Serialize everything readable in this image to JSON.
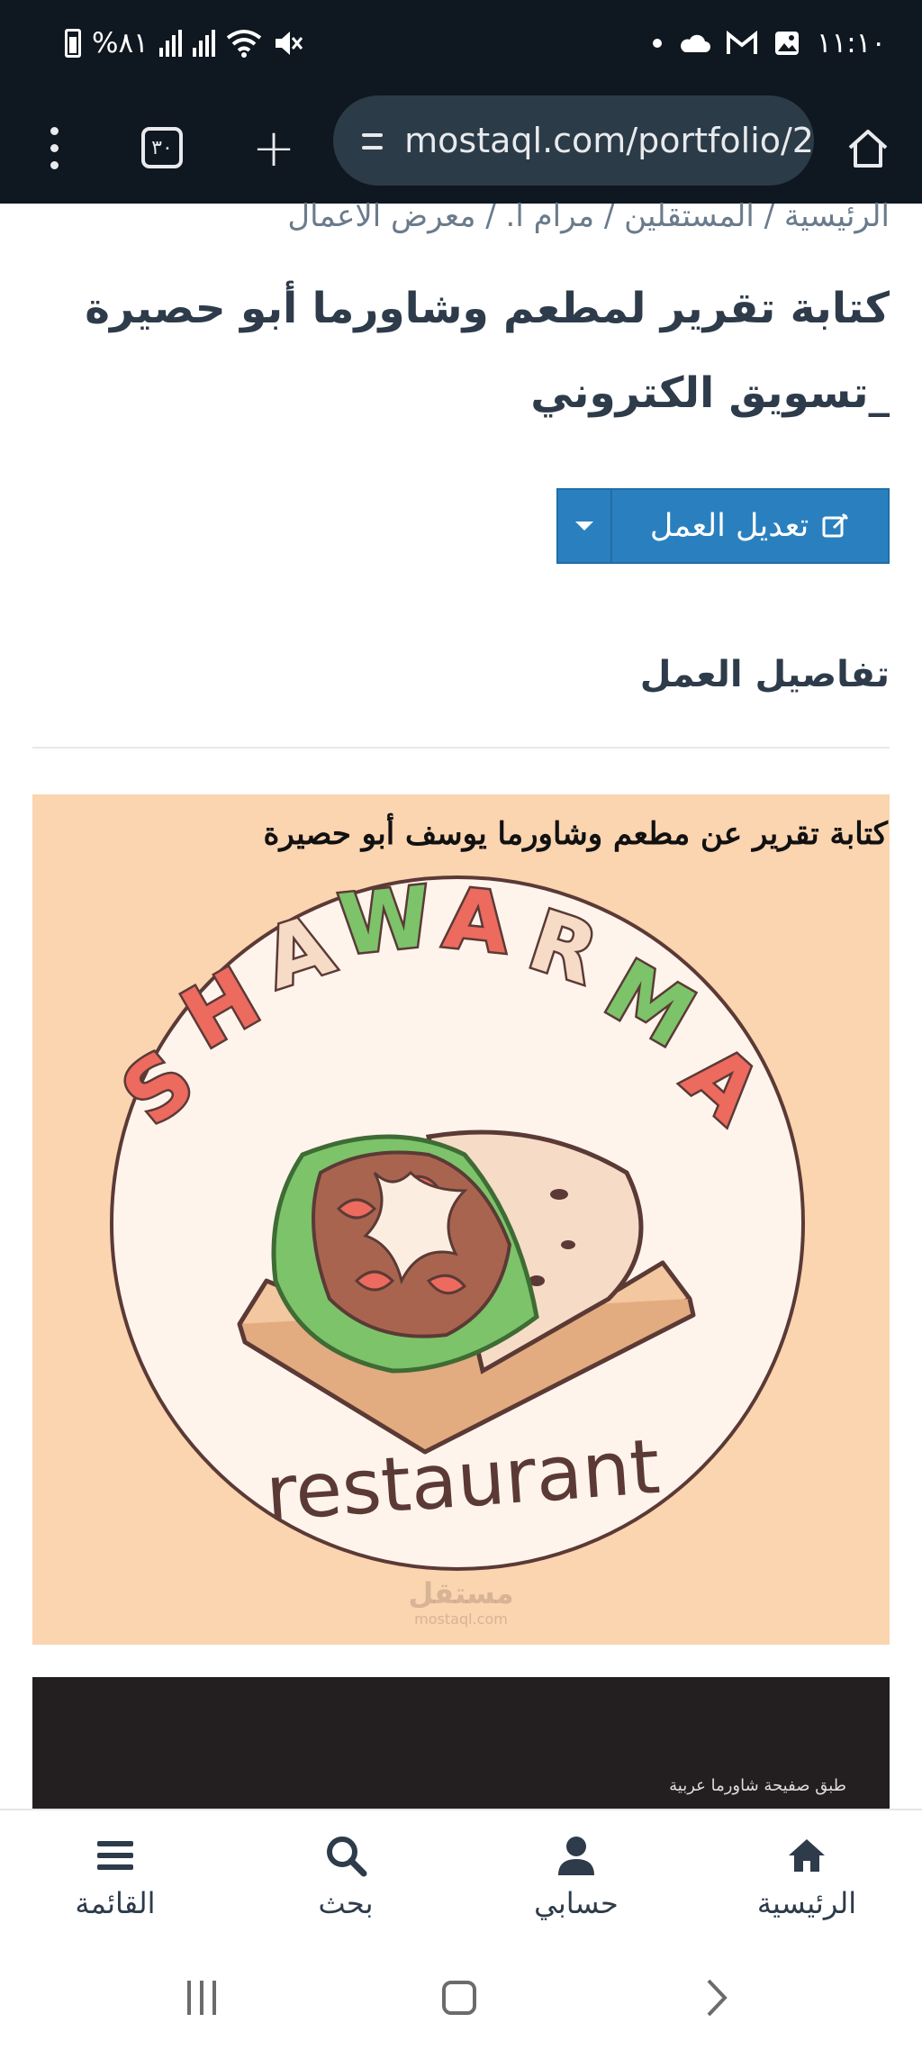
{
  "status_bar": {
    "battery": "%٨١",
    "time": "١١:١٠"
  },
  "browser": {
    "tab_count": "٣٠",
    "url": "mostaql.com/portfolio/2"
  },
  "page": {
    "breadcrumb": "الرئيسية / المستقلين / مرام ا. / معرض الاعمال",
    "title": "كتابة تقرير لمطعم وشاورما أبو حصيرة _تسويق الكتروني",
    "edit_button": "تعديل العمل",
    "section_title": "تفاصيل العمل"
  },
  "artwork": {
    "caption": "كتابة تقرير عن مطعم وشاورما يوسف أبو حصيرة",
    "logo_word": "SHAWARMA",
    "logo_subword": "restaurant",
    "watermark": "مستقل",
    "watermark_sub": "mostaql.com",
    "colors": {
      "background": "#fbd4b0",
      "circle": "#fff4ec",
      "outline": "#5b3a36",
      "red": "#ec6a5e",
      "green": "#7cc36a",
      "cream": "#f6dcc6"
    }
  },
  "second_card": {
    "caption": "طبق صفيحة شاورما عربية"
  },
  "bottom_nav": {
    "home": "الرئيسية",
    "account": "حسابي",
    "search": "بحث",
    "menu": "القائمة"
  }
}
